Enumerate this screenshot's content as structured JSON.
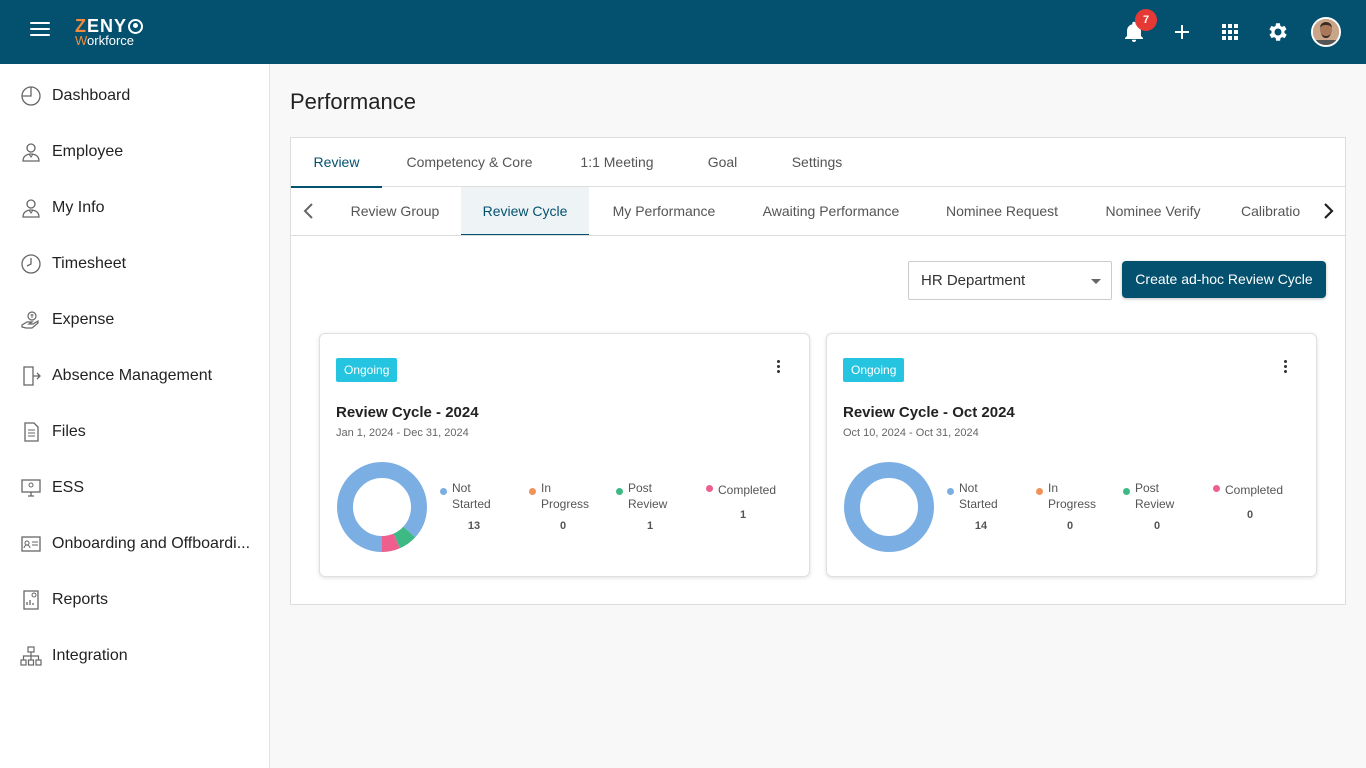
{
  "header": {
    "logo_top": "ZENY",
    "logo_sub": "Workforce",
    "notification_count": "7",
    "icons": [
      "hamburger-icon",
      "bell-icon",
      "plus-icon",
      "apps-grid-icon",
      "settings-gear-icon",
      "user-avatar"
    ]
  },
  "sidebar": {
    "items": [
      {
        "label": "Dashboard",
        "icon": "dashboard-icon"
      },
      {
        "label": "Employee",
        "icon": "employee-icon"
      },
      {
        "label": "My Info",
        "icon": "my-info-icon"
      },
      {
        "label": "Timesheet",
        "icon": "clock-icon"
      },
      {
        "label": "Expense",
        "icon": "expense-icon"
      },
      {
        "label": "Absence Management",
        "icon": "exit-door-icon"
      },
      {
        "label": "Files",
        "icon": "file-icon"
      },
      {
        "label": "ESS",
        "icon": "ess-monitor-icon"
      },
      {
        "label": "Onboarding and Offboardi...",
        "icon": "id-card-icon"
      },
      {
        "label": "Reports",
        "icon": "report-icon"
      },
      {
        "label": "Integration",
        "icon": "hierarchy-icon"
      }
    ]
  },
  "main": {
    "title": "Performance",
    "tabs": [
      "Review",
      "Competency & Core",
      "1:1 Meeting",
      "Goal",
      "Settings"
    ],
    "active_tab": "Review",
    "subtabs": [
      "Review Group",
      "Review Cycle",
      "My Performance",
      "Awaiting Performance",
      "Nominee Request",
      "Nominee Verify",
      "Calibratio"
    ],
    "active_subtab": "Review Cycle",
    "department_select": "HR Department",
    "create_button": "Create ad-hoc Review Cycle",
    "legend_labels": {
      "not_started": [
        "Not",
        "Started"
      ],
      "in_progress": [
        "In",
        "Progress"
      ],
      "post_review": [
        "Post",
        "Review"
      ],
      "completed": [
        "Completed"
      ]
    },
    "colors": {
      "not_started": "#7baee3",
      "in_progress": "#f0935a",
      "post_review": "#3dba84",
      "completed": "#ee5f8e",
      "accent": "#04516f",
      "ongoing_badge": "#25c4e0"
    },
    "cards": [
      {
        "status": "Ongoing",
        "title": "Review Cycle - 2024",
        "dates": "Jan 1, 2024 - Dec 31, 2024",
        "counts": {
          "not_started": "13",
          "in_progress": "0",
          "post_review": "1",
          "completed": "1"
        }
      },
      {
        "status": "Ongoing",
        "title": "Review Cycle - Oct 2024",
        "dates": "Oct 10, 2024 - Oct 31, 2024",
        "counts": {
          "not_started": "14",
          "in_progress": "0",
          "post_review": "0",
          "completed": "0"
        }
      }
    ]
  }
}
